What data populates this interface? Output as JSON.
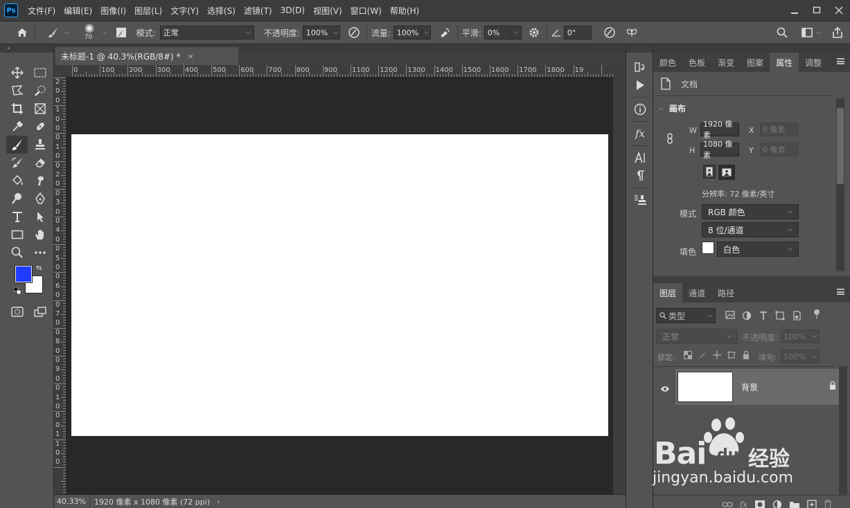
{
  "app": {
    "logo": "Ps"
  },
  "menu": [
    "文件(F)",
    "编辑(E)",
    "图像(I)",
    "图层(L)",
    "文字(Y)",
    "选择(S)",
    "滤镜(T)",
    "3D(D)",
    "视图(V)",
    "窗口(W)",
    "帮助(H)"
  ],
  "options": {
    "brush_size": "70",
    "mode_label": "模式:",
    "mode_value": "正常",
    "opacity_label": "不透明度:",
    "opacity_value": "100%",
    "flow_label": "流量:",
    "flow_value": "100%",
    "smooth_label": "平滑:",
    "smooth_value": "0%",
    "angle_value": "0°"
  },
  "document": {
    "tab_title": "未标题-1 @ 40.3%(RGB/8#) *",
    "close": "×"
  },
  "ruler": {
    "top_labels": [
      "0",
      "100",
      "200",
      "300",
      "400",
      "500",
      "600",
      "700",
      "800",
      "900",
      "1100",
      "1200",
      "1300",
      "1400",
      "1500",
      "1600",
      "1700",
      "1800",
      "19"
    ],
    "left_digits": [
      "2",
      "0",
      "0",
      "1",
      "0",
      "0",
      "0",
      "1",
      "0",
      "0",
      "2",
      "0",
      "0",
      "3",
      "0",
      "0",
      "4",
      "0",
      "0",
      "5",
      "0",
      "0",
      "6",
      "0",
      "0",
      "7",
      "0",
      "0",
      "8",
      "0",
      "0",
      "9",
      "0",
      "0",
      "1",
      "0",
      "0",
      "0",
      "1",
      "1",
      "0",
      "0"
    ]
  },
  "status": {
    "zoom": "40.33%",
    "info": "1920 像素 x 1080 像素 (72 ppi)",
    "arrow": "›"
  },
  "props_panel": {
    "tabs": [
      "颜色",
      "色板",
      "渐变",
      "图案",
      "属性",
      "调整"
    ],
    "doc_label": "文档",
    "canvas_header": "画布",
    "w_label": "W",
    "w_value": "1920 像素",
    "h_label": "H",
    "h_value": "1080 像素",
    "x_label": "X",
    "x_placeholder": "0 像素",
    "y_label": "Y",
    "y_placeholder": "0 像素",
    "resolution": "分辨率: 72 像素/英寸",
    "mode_label": "模式",
    "mode_value": "RGB 颜色",
    "depth_value": "8 位/通道",
    "fill_label": "填色",
    "fill_value": "白色"
  },
  "layers_panel": {
    "tabs": [
      "图层",
      "通道",
      "路径"
    ],
    "filter_placeholder": "类型",
    "blend_mode": "正常",
    "opacity_label": "不透明度:",
    "opacity_value": "100%",
    "lock_label": "锁定:",
    "fill_label": "填充:",
    "fill_value": "100%",
    "layer_name": "背景"
  },
  "watermark": {
    "brand": "Bai",
    "du": "du",
    "jingyan": "经验",
    "url": "jingyan.baidu.com"
  },
  "colors": {
    "foreground": "#1f3cff",
    "background": "#ffffff",
    "canvas": "#ffffff",
    "workspace": "#282828",
    "ui": "#535353",
    "menubar": "#3c3c3c"
  }
}
